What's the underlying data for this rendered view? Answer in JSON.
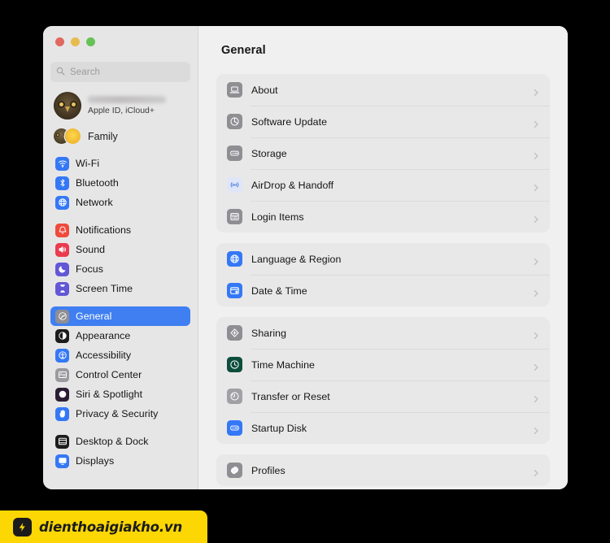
{
  "window": {
    "traffic_lights": [
      {
        "name": "close",
        "color": "#e0695f"
      },
      {
        "name": "minimize",
        "color": "#e8bb4d"
      },
      {
        "name": "zoom",
        "color": "#66c257"
      }
    ]
  },
  "sidebar": {
    "search": {
      "placeholder": "Search",
      "value": "",
      "icon": "search-icon"
    },
    "account": {
      "name": "",
      "name_redacted": true,
      "subtitle": "Apple ID, iCloud+",
      "avatar_icon": "owl-avatar"
    },
    "family": {
      "label": "Family",
      "avatar_icon": "family-avatars"
    },
    "groups": [
      {
        "items": [
          {
            "label": "Wi-Fi",
            "icon": "wifi-icon",
            "color": "#3478f6",
            "glyph": "wifi",
            "selected": false
          },
          {
            "label": "Bluetooth",
            "icon": "bluetooth-icon",
            "color": "#3478f6",
            "glyph": "bluetooth",
            "selected": false
          },
          {
            "label": "Network",
            "icon": "network-icon",
            "color": "#3478f6",
            "glyph": "globe",
            "selected": false
          }
        ]
      },
      {
        "items": [
          {
            "label": "Notifications",
            "icon": "notifications-icon",
            "color": "#ef4a3c",
            "glyph": "bell",
            "selected": false
          },
          {
            "label": "Sound",
            "icon": "sound-icon",
            "color": "#ea3b4f",
            "glyph": "speaker",
            "selected": false
          },
          {
            "label": "Focus",
            "icon": "focus-icon",
            "color": "#6257d6",
            "glyph": "moon",
            "selected": false
          },
          {
            "label": "Screen Time",
            "icon": "screen-time-icon",
            "color": "#6257d6",
            "glyph": "hourglass",
            "selected": false
          }
        ]
      },
      {
        "items": [
          {
            "label": "General",
            "icon": "general-icon",
            "color": "#8e8e93",
            "glyph": "gear",
            "selected": true
          },
          {
            "label": "Appearance",
            "icon": "appearance-icon",
            "color": "#1c1c1e",
            "glyph": "halfcircle",
            "selected": false
          },
          {
            "label": "Accessibility",
            "icon": "accessibility-icon",
            "color": "#3478f6",
            "glyph": "person",
            "selected": false
          },
          {
            "label": "Control Center",
            "icon": "control-center-icon",
            "color": "#9a9a9f",
            "glyph": "sliders",
            "selected": false
          },
          {
            "label": "Siri & Spotlight",
            "icon": "siri-spotlight-icon",
            "color": "#2b1d33",
            "glyph": "siri",
            "selected": false
          },
          {
            "label": "Privacy & Security",
            "icon": "privacy-security-icon",
            "color": "#3478f6",
            "glyph": "hand",
            "selected": false
          }
        ]
      },
      {
        "items": [
          {
            "label": "Desktop & Dock",
            "icon": "desktop-dock-icon",
            "color": "#1c1c1e",
            "glyph": "window",
            "selected": false
          },
          {
            "label": "Displays",
            "icon": "displays-icon",
            "color": "#3478f6",
            "glyph": "display",
            "selected": false
          }
        ]
      }
    ]
  },
  "main": {
    "title": "General",
    "chevron_icon": "chevron-right-icon",
    "cards": [
      {
        "rows": [
          {
            "label": "About",
            "icon": "about-icon",
            "color": "#8e8e93",
            "glyph": "laptop"
          },
          {
            "label": "Software Update",
            "icon": "software-update-icon",
            "color": "#8e8e93",
            "glyph": "gearpie"
          },
          {
            "label": "Storage",
            "icon": "storage-icon",
            "color": "#8e8e93",
            "glyph": "drive"
          },
          {
            "label": "AirDrop & Handoff",
            "icon": "airdrop-handoff-icon",
            "color": "#dfe6f7",
            "glyph": "airdrop"
          },
          {
            "label": "Login Items",
            "icon": "login-items-icon",
            "color": "#8e8e93",
            "glyph": "list"
          }
        ]
      },
      {
        "rows": [
          {
            "label": "Language & Region",
            "icon": "language-region-icon",
            "color": "#3478f6",
            "glyph": "globe"
          },
          {
            "label": "Date & Time",
            "icon": "date-time-icon",
            "color": "#3478f6",
            "glyph": "calendarclock"
          }
        ]
      },
      {
        "rows": [
          {
            "label": "Sharing",
            "icon": "sharing-icon",
            "color": "#8e8e93",
            "glyph": "sharing"
          },
          {
            "label": "Time Machine",
            "icon": "time-machine-icon",
            "color": "#0c4d3c",
            "glyph": "clockback"
          },
          {
            "label": "Transfer or Reset",
            "icon": "transfer-reset-icon",
            "color": "#a0a0a5",
            "glyph": "reset"
          },
          {
            "label": "Startup Disk",
            "icon": "startup-disk-icon",
            "color": "#3478f6",
            "glyph": "drive"
          }
        ]
      },
      {
        "rows": [
          {
            "label": "Profiles",
            "icon": "profiles-icon",
            "color": "#8e8e93",
            "glyph": "badgecheck"
          }
        ]
      }
    ]
  },
  "watermark": {
    "text": "dienthoaigiakho.vn",
    "logo_icon": "lightning-logo",
    "background": "#fcd703",
    "foreground": "#1b1b1b"
  }
}
